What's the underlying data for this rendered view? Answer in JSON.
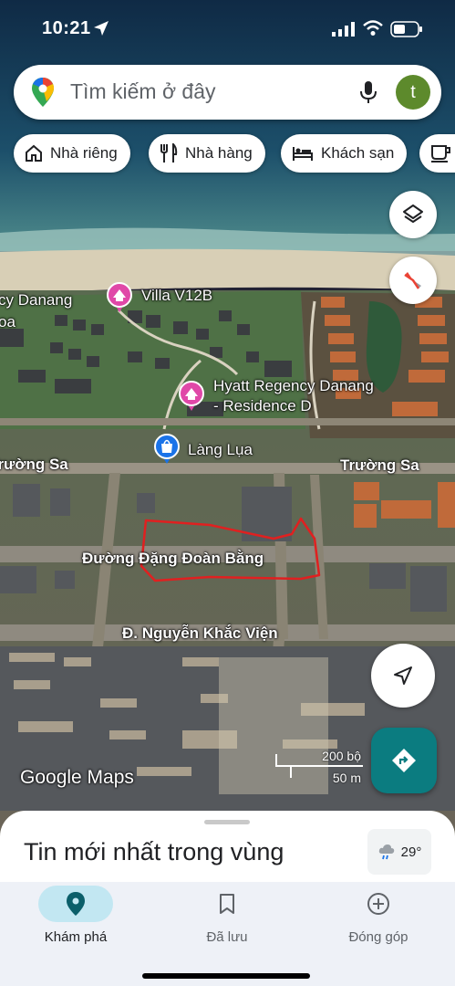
{
  "status_bar": {
    "time": "10:21"
  },
  "search": {
    "placeholder": "Tìm kiếm ở đây",
    "avatar_letter": "t"
  },
  "chips": [
    {
      "label": "Nhà riêng",
      "icon": "home-icon"
    },
    {
      "label": "Nhà hàng",
      "icon": "restaurant-icon"
    },
    {
      "label": "Khách sạn",
      "icon": "hotel-icon"
    },
    {
      "label": "",
      "icon": "coffee-icon"
    }
  ],
  "map": {
    "type": "satellite",
    "places": [
      {
        "label": "Villa V12B",
        "icon": "hotel-pin-icon",
        "color": "#e048a8"
      },
      {
        "label": "Hyatt Regency Danang - Residence D",
        "icon": "hotel-pin-icon",
        "color": "#e048a8"
      },
      {
        "label": "Làng Lụa",
        "icon": "shopping-pin-icon",
        "color": "#1a73e8"
      }
    ],
    "partial_labels": [
      "cy Danang",
      "oa"
    ],
    "roads": [
      "Trường Sa",
      "Trường Sa",
      "Đường Đặng Đoàn Bằng",
      "Đ. Nguyễn Khắc Viện"
    ],
    "scale": {
      "imperial": "200 bộ",
      "metric": "50 m"
    },
    "watermark": "Google Maps",
    "annotation_color": "#e02020"
  },
  "sheet": {
    "title": "Tin mới nhất trong vùng",
    "weather": "29°"
  },
  "nav": [
    {
      "label": "Khám phá",
      "icon": "explore-pin-icon",
      "active": true
    },
    {
      "label": "Đã lưu",
      "icon": "bookmark-icon",
      "active": false
    },
    {
      "label": "Đóng góp",
      "icon": "add-circle-icon",
      "active": false
    }
  ]
}
